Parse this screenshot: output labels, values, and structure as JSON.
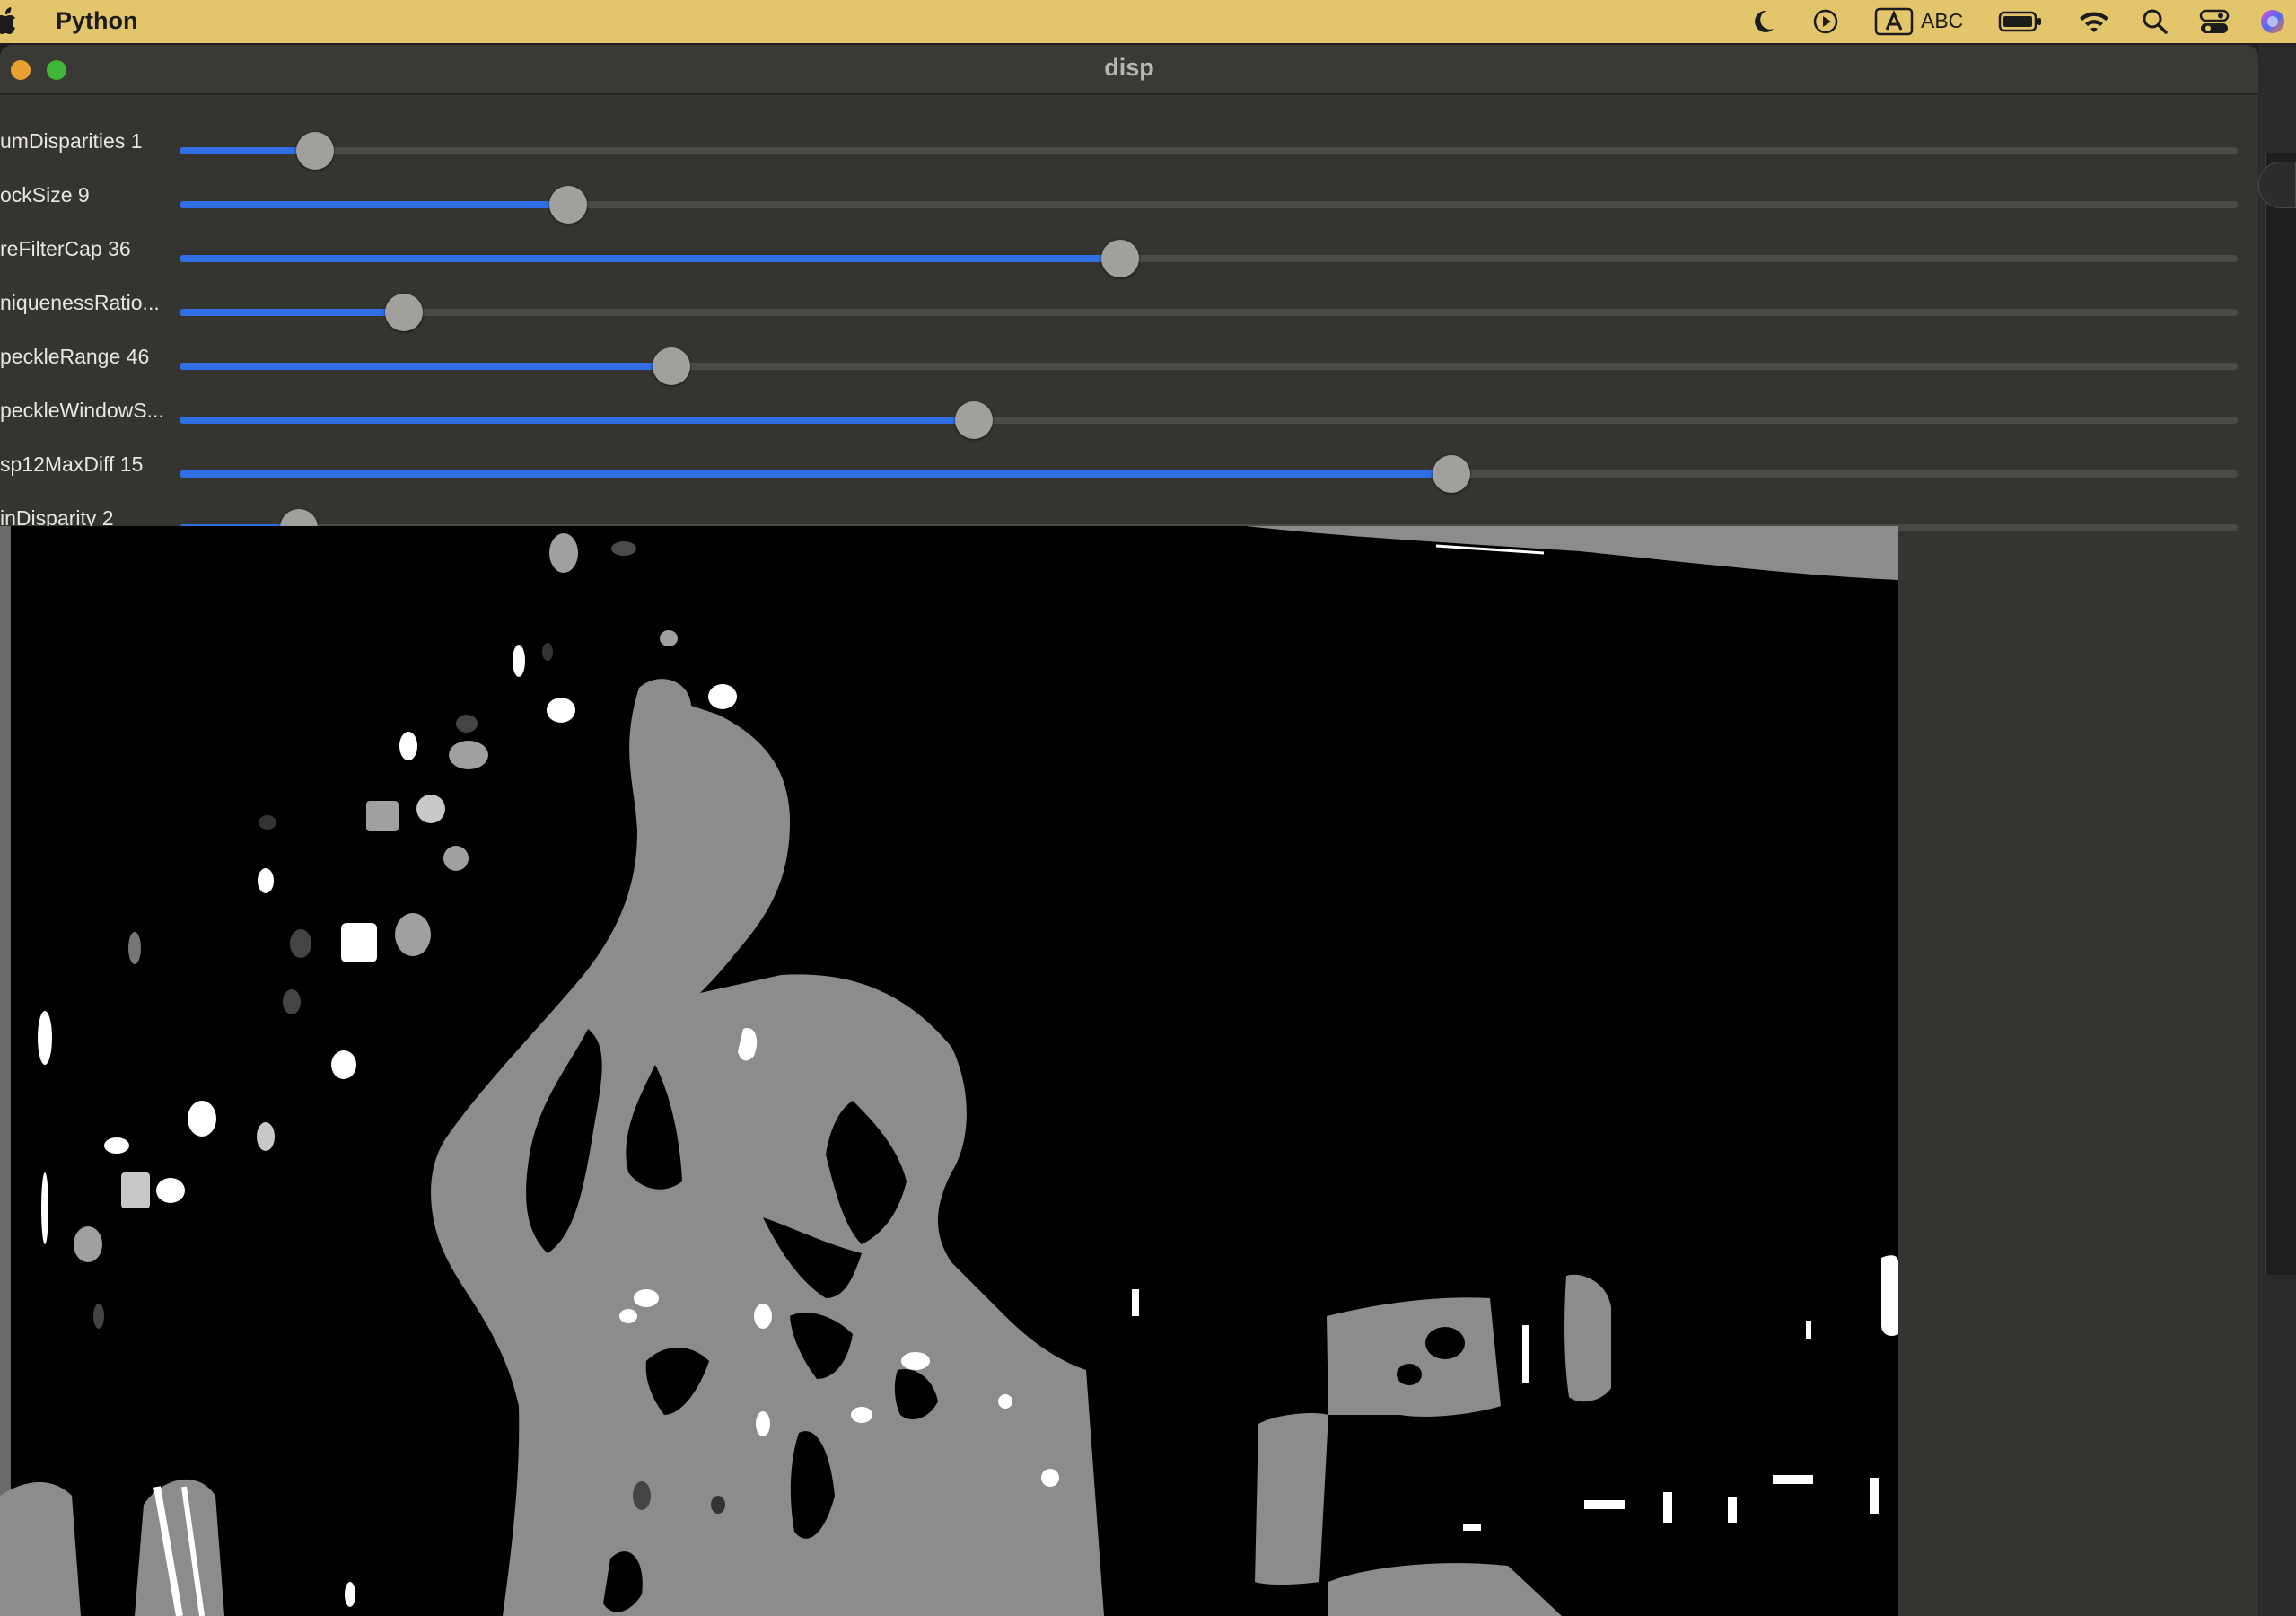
{
  "menubar": {
    "app_name": "Python",
    "input_source": "ABC",
    "icons": [
      "apple-icon",
      "moon-icon",
      "play-circle-icon",
      "input-a-icon",
      "battery-icon",
      "wifi-icon",
      "search-icon",
      "control-center-icon",
      "siri-icon"
    ],
    "background_color": "#e3c56c"
  },
  "window": {
    "title": "disp",
    "traffic_lights": [
      "close",
      "minimize",
      "zoom"
    ],
    "traffic_colors": {
      "minimize": "#e7a12f",
      "zoom": "#3fb63a"
    }
  },
  "sliders": [
    {
      "label": "umDisparities 1",
      "value_fraction": 0.066
    },
    {
      "label": "ockSize 9",
      "value_fraction": 0.189
    },
    {
      "label": "reFilterCap 36",
      "value_fraction": 0.457
    },
    {
      "label": "niquenessRatio...",
      "value_fraction": 0.109
    },
    {
      "label": "peckleRange 46",
      "value_fraction": 0.239
    },
    {
      "label": "peckleWindowS...",
      "value_fraction": 0.386
    },
    {
      "label": "sp12MaxDiff 15",
      "value_fraction": 0.618
    },
    {
      "label": "inDisparity 2",
      "value_fraction": 0.058
    }
  ],
  "accent_color": "#2f6ee3",
  "image": {
    "name": "disparity-map",
    "colors": [
      "#000000",
      "#8c8c8c",
      "#ffffff"
    ]
  }
}
